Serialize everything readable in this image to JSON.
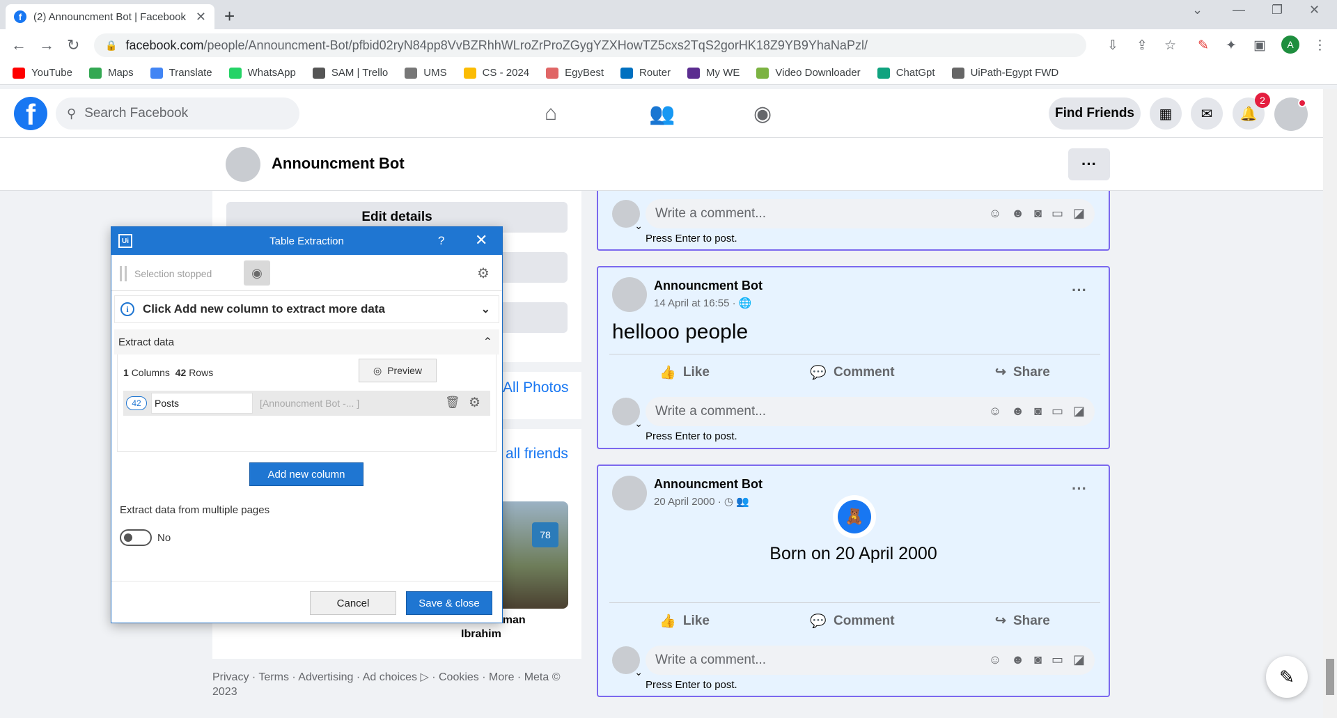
{
  "browser": {
    "tab_title": "(2) Announcment Bot | Facebook",
    "tab_close": "✕",
    "new_tab": "+",
    "url_host": "facebook.com",
    "url_path": "/people/Announcment-Bot/pfbid02ryN84pp8VvBZRhhWLroZrProZGygYZXHowTZ5cxs2TqS2gorHK18Z9YB9YhaNaPzl/",
    "profile_initial": "A",
    "bookmarks": [
      {
        "label": "YouTube",
        "color": "#ff0000"
      },
      {
        "label": "Maps",
        "color": "#34a853"
      },
      {
        "label": "Translate",
        "color": "#4285f4"
      },
      {
        "label": "WhatsApp",
        "color": "#25d366"
      },
      {
        "label": "SAM | Trello",
        "color": "#555555"
      },
      {
        "label": "UMS",
        "color": "#777777"
      },
      {
        "label": "CS - 2024",
        "color": "#fbbc04"
      },
      {
        "label": "EgyBest",
        "color": "#e06666"
      },
      {
        "label": "Router",
        "color": "#0070c0"
      },
      {
        "label": "My WE",
        "color": "#5b2d90"
      },
      {
        "label": "Video Downloader",
        "color": "#7cb342"
      },
      {
        "label": "ChatGpt",
        "color": "#10a37f"
      },
      {
        "label": "UiPath-Egypt FWD",
        "color": "#666666"
      }
    ]
  },
  "facebook": {
    "search_placeholder": "Search Facebook",
    "find_friends": "Find Friends",
    "notification_count": "2",
    "profile_name": "Announcment Bot",
    "left": {
      "edit_details": "Edit details",
      "all_photos": "All Photos",
      "all_friends": "all friends",
      "friend_caption_1": "hman",
      "friend_caption_2": "Ibrahim",
      "sign_text": "78",
      "footer": "Privacy · Terms · Advertising · Ad choices ▷ · Cookies · More · Meta © 2023"
    },
    "comment_placeholder": "Write a comment...",
    "press_enter": "Press Enter to post.",
    "actions": {
      "like": "Like",
      "comment": "Comment",
      "share": "Share"
    },
    "posts": [
      {
        "author": "Announcment Bot",
        "date": "14 April at 16:55 ·",
        "text": "hellooo people"
      },
      {
        "author": "Announcment Bot",
        "date": "20 April 2000 ·",
        "text": "Born on 20 April 2000"
      }
    ]
  },
  "dialog": {
    "logo": "Ui",
    "title": "Table Extraction",
    "help": "?",
    "close": "✕",
    "selection_status": "Selection stopped",
    "info_text": "Click Add new column to extract more data",
    "extract_header": "Extract data",
    "columns_count": "1",
    "columns_label": "Columns",
    "rows_count": "42",
    "rows_label": "Rows",
    "preview": "Preview",
    "column": {
      "count": "42",
      "name": "Posts",
      "selector": "[Announcment Bot -...  ]"
    },
    "add_column": "Add new column",
    "multi_pages_label": "Extract data from multiple pages",
    "multi_pages_value": "No",
    "cancel": "Cancel",
    "save_close": "Save & close"
  }
}
